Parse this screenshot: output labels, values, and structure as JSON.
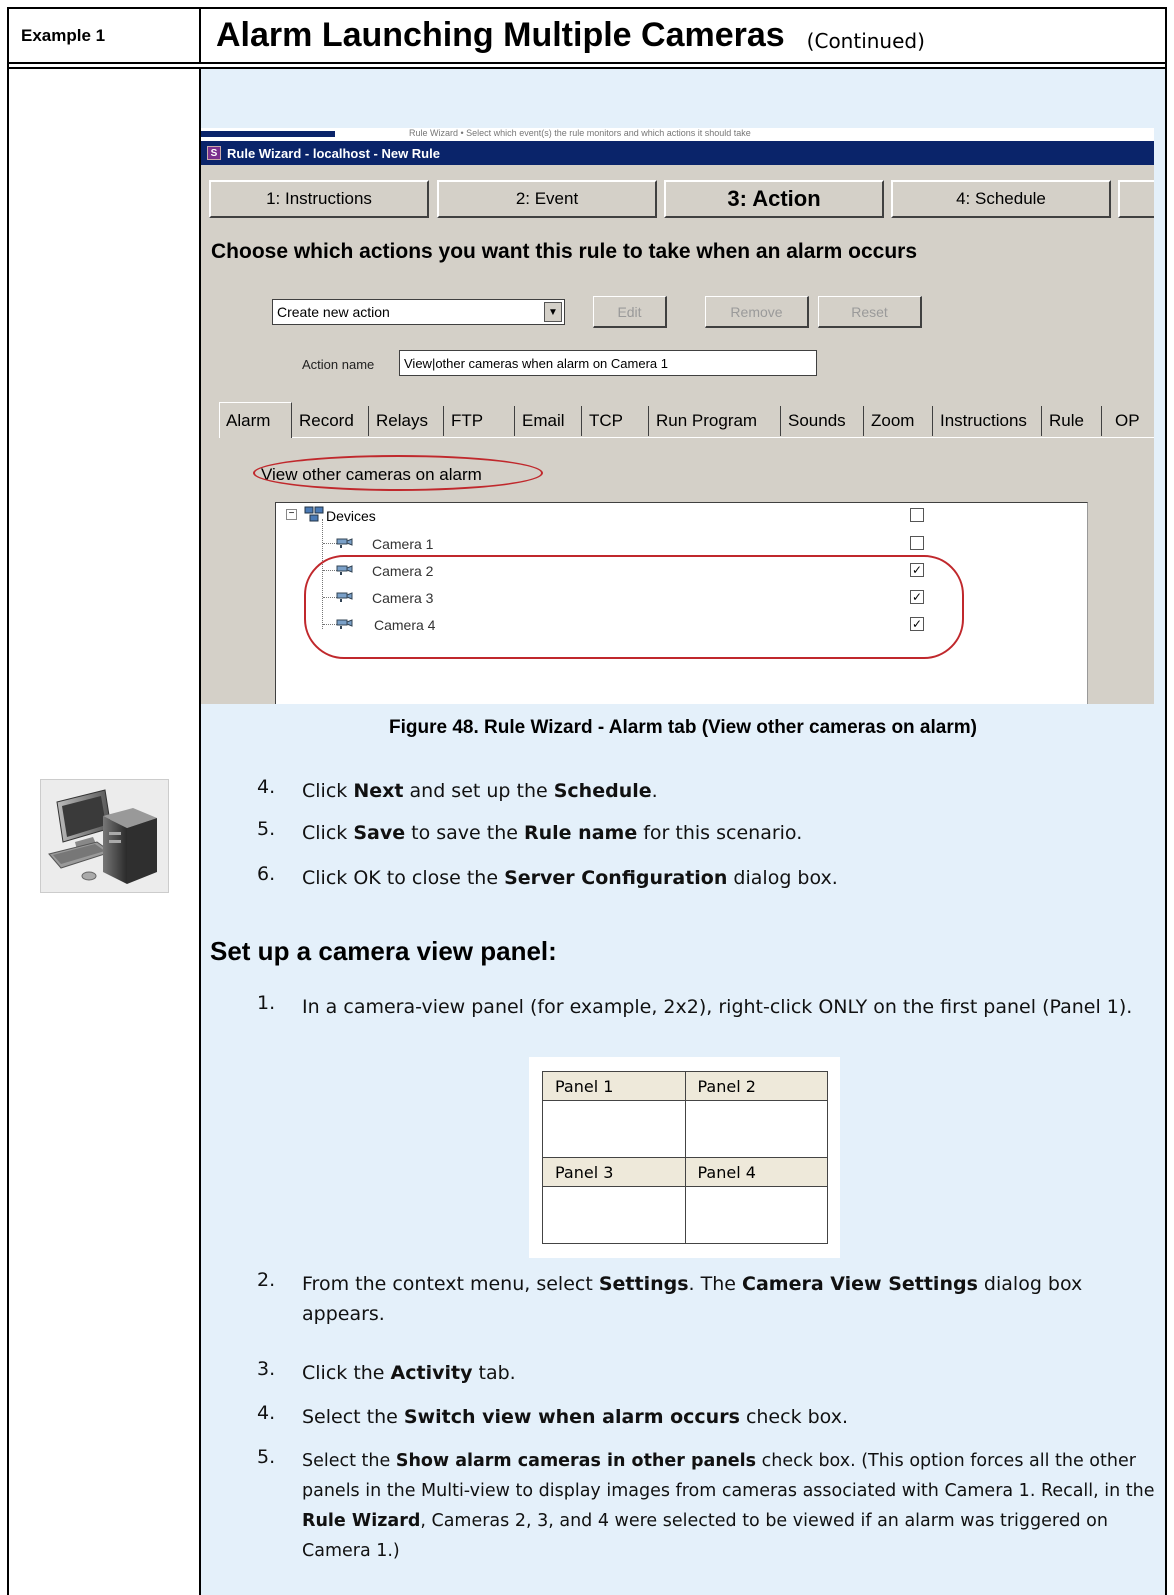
{
  "header": {
    "example_label": "Example 1",
    "title": "Alarm Launching Multiple Cameras",
    "subtitle": "(Continued)"
  },
  "screenshot": {
    "background_text": "Rule Wizard  •  Select which event(s) the rule monitors and which actions it should take",
    "window_title": "Rule Wizard - localhost - New Rule",
    "app_icon": "S",
    "steps": [
      "1: Instructions",
      "2: Event",
      "3: Action",
      "4: Schedule"
    ],
    "heading": "Choose which actions you want this rule to take when an alarm occurs",
    "action_select": "Create new action",
    "buttons": {
      "edit": "Edit",
      "remove": "Remove",
      "reset": "Reset"
    },
    "action_name_label": "Action name",
    "action_name_value": "View|other cameras when alarm on Camera 1",
    "tabs": [
      "Alarm",
      "Record",
      "Relays",
      "FTP",
      "Email",
      "TCP",
      "Run Program",
      "Sounds",
      "Zoom",
      "Instructions",
      "Rule",
      "OP"
    ],
    "view_other_label": "View other cameras on alarm",
    "tree": {
      "root": "Devices",
      "cameras": [
        {
          "name": "Camera 1",
          "checked": false
        },
        {
          "name": "Camera 2",
          "checked": true
        },
        {
          "name": "Camera 3",
          "checked": true
        },
        {
          "name": "Camera 4",
          "checked": true
        }
      ]
    },
    "colors": {
      "titlebar": "#0a246a",
      "window": "#d4d0c8",
      "annotation": "#c0282c"
    }
  },
  "caption": "Figure 48. Rule Wizard - Alarm tab (View other cameras on alarm)",
  "steps_a": [
    {
      "num": "4.",
      "pre": "Click ",
      "b1": "Next",
      "mid": " and set up the ",
      "b2": "Schedule",
      "post": "."
    },
    {
      "num": "5.",
      "pre": "Click ",
      "b1": "Save",
      "mid": " to save the ",
      "b2": "Rule name",
      "post": " for this scenario."
    },
    {
      "num": "6.",
      "pre": "Click OK to close the ",
      "b1": "Server Configuration",
      "mid": " dialog box.",
      "b2": "",
      "post": ""
    }
  ],
  "section_heading": "Set up a camera view panel:",
  "steps_b1": {
    "num": "1.",
    "text": "In a camera-view panel (for example, 2x2), right-click ONLY on the first panel (Panel 1)."
  },
  "panels": [
    "Panel 1",
    "Panel 2",
    "Panel 3",
    "Panel 4"
  ],
  "steps_b2": [
    {
      "num": "2.",
      "pre": "From the context menu, select ",
      "b1": "Settings",
      "mid": ". The ",
      "b2": "Camera View Settings",
      "post": " dialog box appears."
    },
    {
      "num": "3.",
      "pre": "Click the ",
      "b1": "Activity",
      "mid": " tab.",
      "b2": "",
      "post": ""
    },
    {
      "num": "4.",
      "pre": "Select the ",
      "b1": "Switch view when alarm occurs",
      "mid": " check box.",
      "b2": "",
      "post": ""
    },
    {
      "num": "5.",
      "pre": "Select the ",
      "b1": "Show alarm cameras in other panels",
      "mid": " check box. (This option forces all the other panels in the Multi-view to display images from cameras associated with Camera 1. Recall, in the ",
      "b2": "Rule Wizard",
      "post": ", Cameras 2, 3, and 4 were selected to be viewed if an alarm was triggered on Camera 1.)"
    }
  ],
  "icons": {
    "computer": "desktop-computer-icon",
    "camera": "camera-icon",
    "devices": "network-devices-icon"
  }
}
